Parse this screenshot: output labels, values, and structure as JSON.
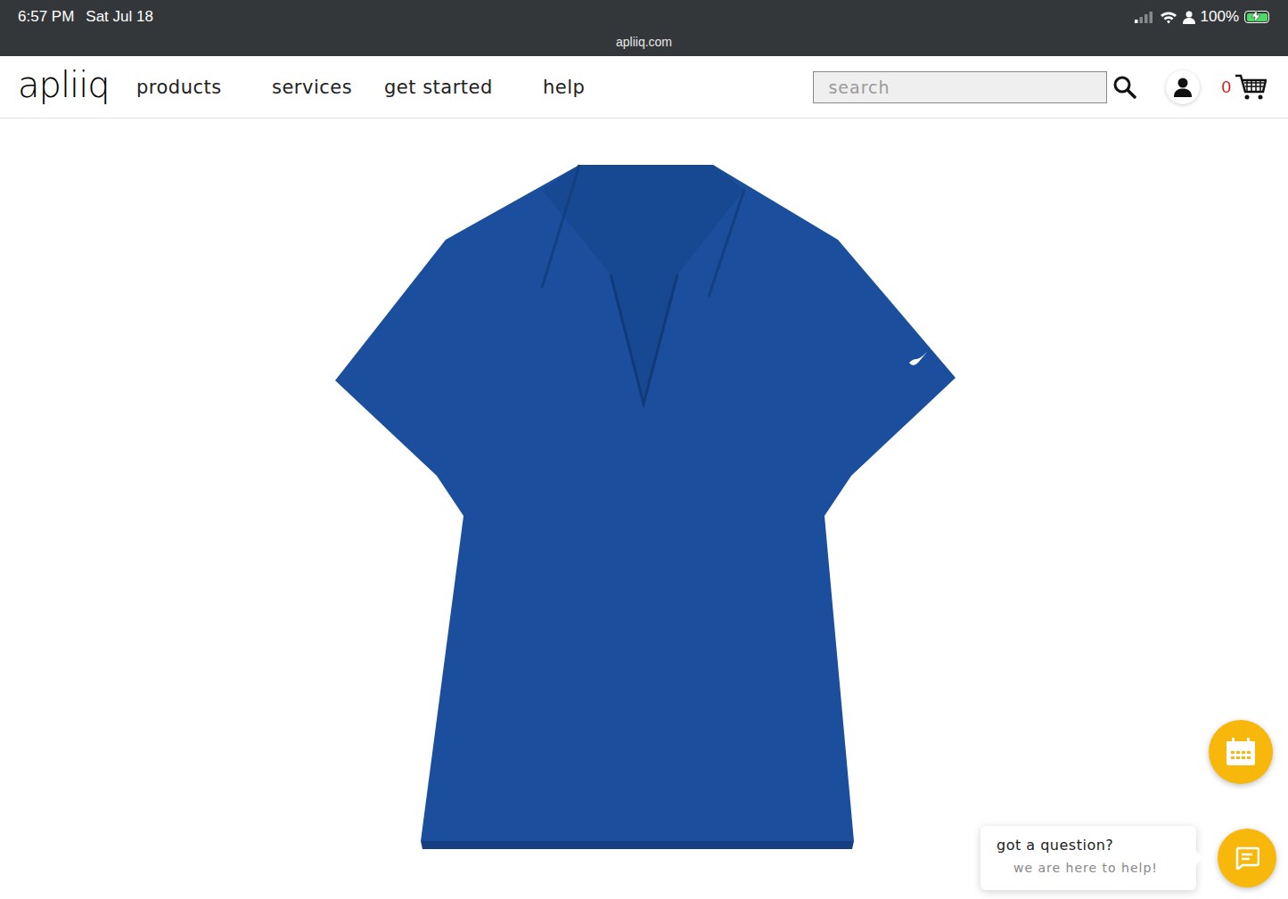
{
  "status_bar": {
    "time": "6:57 PM",
    "date": "Sat Jul 18",
    "url": "apliiq.com",
    "battery": {
      "text": "100%",
      "level": 1,
      "charging": true
    }
  },
  "nav": {
    "logo": "apliiq",
    "items": [
      {
        "label": "products"
      },
      {
        "label": "services"
      },
      {
        "label": "get started"
      },
      {
        "label": "help"
      }
    ],
    "search": {
      "placeholder": "search"
    },
    "cart": {
      "count": "0"
    }
  },
  "chat": {
    "title": "got a question?",
    "subtitle": "we are here to help!"
  }
}
